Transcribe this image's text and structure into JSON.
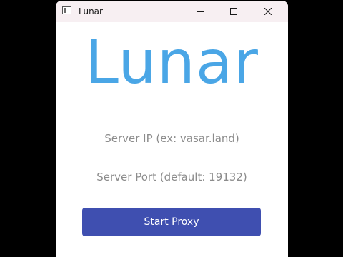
{
  "window": {
    "title": "Lunar",
    "controls": {
      "minimize_icon": "minimize-icon",
      "maximize_icon": "maximize-icon",
      "close_icon": "close-icon"
    }
  },
  "main": {
    "logo_text": "Lunar",
    "server_ip": {
      "value": "",
      "placeholder": "Server IP (ex: vasar.land)"
    },
    "server_port": {
      "value": "",
      "placeholder": "Server Port (default: 19132)"
    },
    "start_button_label": "Start Proxy"
  },
  "colors": {
    "logo": "#4aa6e6",
    "button": "#3f4fb0",
    "titlebar": "#f7eff2",
    "placeholder": "#8c8c8c"
  }
}
